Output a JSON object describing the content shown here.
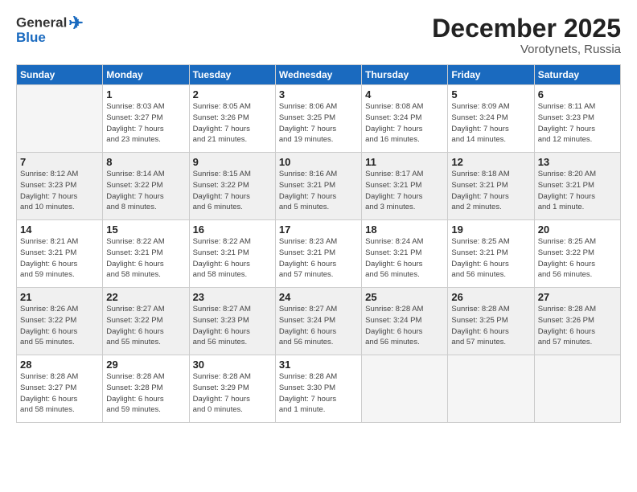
{
  "header": {
    "logo_general": "General",
    "logo_blue": "Blue",
    "month": "December 2025",
    "location": "Vorotynets, Russia"
  },
  "days_of_week": [
    "Sunday",
    "Monday",
    "Tuesday",
    "Wednesday",
    "Thursday",
    "Friday",
    "Saturday"
  ],
  "weeks": [
    [
      {
        "day": "",
        "info": ""
      },
      {
        "day": "1",
        "info": "Sunrise: 8:03 AM\nSunset: 3:27 PM\nDaylight: 7 hours\nand 23 minutes."
      },
      {
        "day": "2",
        "info": "Sunrise: 8:05 AM\nSunset: 3:26 PM\nDaylight: 7 hours\nand 21 minutes."
      },
      {
        "day": "3",
        "info": "Sunrise: 8:06 AM\nSunset: 3:25 PM\nDaylight: 7 hours\nand 19 minutes."
      },
      {
        "day": "4",
        "info": "Sunrise: 8:08 AM\nSunset: 3:24 PM\nDaylight: 7 hours\nand 16 minutes."
      },
      {
        "day": "5",
        "info": "Sunrise: 8:09 AM\nSunset: 3:24 PM\nDaylight: 7 hours\nand 14 minutes."
      },
      {
        "day": "6",
        "info": "Sunrise: 8:11 AM\nSunset: 3:23 PM\nDaylight: 7 hours\nand 12 minutes."
      }
    ],
    [
      {
        "day": "7",
        "info": "Sunrise: 8:12 AM\nSunset: 3:23 PM\nDaylight: 7 hours\nand 10 minutes."
      },
      {
        "day": "8",
        "info": "Sunrise: 8:14 AM\nSunset: 3:22 PM\nDaylight: 7 hours\nand 8 minutes."
      },
      {
        "day": "9",
        "info": "Sunrise: 8:15 AM\nSunset: 3:22 PM\nDaylight: 7 hours\nand 6 minutes."
      },
      {
        "day": "10",
        "info": "Sunrise: 8:16 AM\nSunset: 3:21 PM\nDaylight: 7 hours\nand 5 minutes."
      },
      {
        "day": "11",
        "info": "Sunrise: 8:17 AM\nSunset: 3:21 PM\nDaylight: 7 hours\nand 3 minutes."
      },
      {
        "day": "12",
        "info": "Sunrise: 8:18 AM\nSunset: 3:21 PM\nDaylight: 7 hours\nand 2 minutes."
      },
      {
        "day": "13",
        "info": "Sunrise: 8:20 AM\nSunset: 3:21 PM\nDaylight: 7 hours\nand 1 minute."
      }
    ],
    [
      {
        "day": "14",
        "info": "Sunrise: 8:21 AM\nSunset: 3:21 PM\nDaylight: 6 hours\nand 59 minutes."
      },
      {
        "day": "15",
        "info": "Sunrise: 8:22 AM\nSunset: 3:21 PM\nDaylight: 6 hours\nand 58 minutes."
      },
      {
        "day": "16",
        "info": "Sunrise: 8:22 AM\nSunset: 3:21 PM\nDaylight: 6 hours\nand 58 minutes."
      },
      {
        "day": "17",
        "info": "Sunrise: 8:23 AM\nSunset: 3:21 PM\nDaylight: 6 hours\nand 57 minutes."
      },
      {
        "day": "18",
        "info": "Sunrise: 8:24 AM\nSunset: 3:21 PM\nDaylight: 6 hours\nand 56 minutes."
      },
      {
        "day": "19",
        "info": "Sunrise: 8:25 AM\nSunset: 3:21 PM\nDaylight: 6 hours\nand 56 minutes."
      },
      {
        "day": "20",
        "info": "Sunrise: 8:25 AM\nSunset: 3:22 PM\nDaylight: 6 hours\nand 56 minutes."
      }
    ],
    [
      {
        "day": "21",
        "info": "Sunrise: 8:26 AM\nSunset: 3:22 PM\nDaylight: 6 hours\nand 55 minutes."
      },
      {
        "day": "22",
        "info": "Sunrise: 8:27 AM\nSunset: 3:22 PM\nDaylight: 6 hours\nand 55 minutes."
      },
      {
        "day": "23",
        "info": "Sunrise: 8:27 AM\nSunset: 3:23 PM\nDaylight: 6 hours\nand 56 minutes."
      },
      {
        "day": "24",
        "info": "Sunrise: 8:27 AM\nSunset: 3:24 PM\nDaylight: 6 hours\nand 56 minutes."
      },
      {
        "day": "25",
        "info": "Sunrise: 8:28 AM\nSunset: 3:24 PM\nDaylight: 6 hours\nand 56 minutes."
      },
      {
        "day": "26",
        "info": "Sunrise: 8:28 AM\nSunset: 3:25 PM\nDaylight: 6 hours\nand 57 minutes."
      },
      {
        "day": "27",
        "info": "Sunrise: 8:28 AM\nSunset: 3:26 PM\nDaylight: 6 hours\nand 57 minutes."
      }
    ],
    [
      {
        "day": "28",
        "info": "Sunrise: 8:28 AM\nSunset: 3:27 PM\nDaylight: 6 hours\nand 58 minutes."
      },
      {
        "day": "29",
        "info": "Sunrise: 8:28 AM\nSunset: 3:28 PM\nDaylight: 6 hours\nand 59 minutes."
      },
      {
        "day": "30",
        "info": "Sunrise: 8:28 AM\nSunset: 3:29 PM\nDaylight: 7 hours\nand 0 minutes."
      },
      {
        "day": "31",
        "info": "Sunrise: 8:28 AM\nSunset: 3:30 PM\nDaylight: 7 hours\nand 1 minute."
      },
      {
        "day": "",
        "info": ""
      },
      {
        "day": "",
        "info": ""
      },
      {
        "day": "",
        "info": ""
      }
    ]
  ]
}
